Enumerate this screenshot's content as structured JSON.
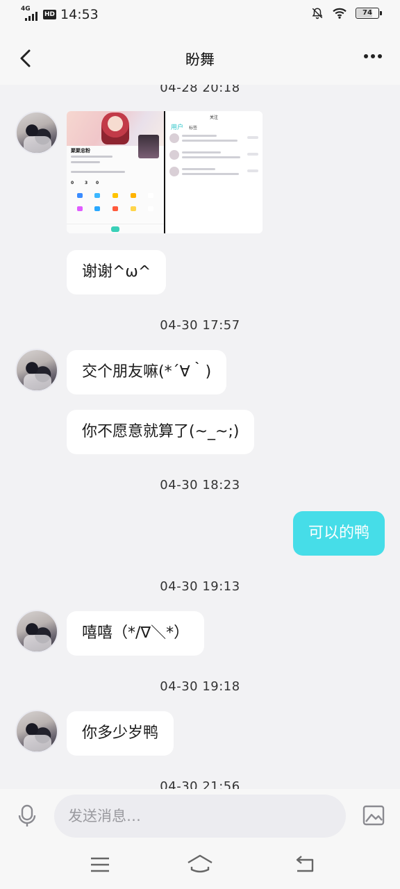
{
  "status_bar": {
    "network": "4G",
    "hd": "HD",
    "time": "14:53",
    "battery": "74",
    "icons": [
      "signal-icon",
      "hd-icon",
      "bell-muted-icon",
      "wifi-icon",
      "battery-icon"
    ]
  },
  "header": {
    "title": "盼舞",
    "back_icon": "chevron-left-icon",
    "more_icon": "more-dots-icon"
  },
  "messages": [
    {
      "type": "timestamp",
      "text": "04-28 20:18"
    },
    {
      "type": "image",
      "from": "other",
      "alt": "screenshot-thumbnail"
    },
    {
      "type": "text",
      "from": "other",
      "text": "谢谢^ω^"
    },
    {
      "type": "timestamp",
      "text": "04-30 17:57"
    },
    {
      "type": "text",
      "from": "other",
      "text": "交个朋友嘛(*´∀｀)"
    },
    {
      "type": "text",
      "from": "other",
      "text": "你不愿意就算了(~_~;)"
    },
    {
      "type": "timestamp",
      "text": "04-30 18:23"
    },
    {
      "type": "text",
      "from": "me",
      "text": "可以的鸭"
    },
    {
      "type": "timestamp",
      "text": "04-30 19:13"
    },
    {
      "type": "text",
      "from": "other",
      "text": "嘻嘻（*/∇＼*）"
    },
    {
      "type": "timestamp",
      "text": "04-30 19:18"
    },
    {
      "type": "text",
      "from": "other",
      "text": "你多少岁鸭"
    },
    {
      "type": "timestamp",
      "text": "04-30 21:56"
    }
  ],
  "image_thumbnail": {
    "left_name": "聚聚忠粉",
    "left_stats": [
      "0",
      "3",
      "0"
    ],
    "right_title": "关注",
    "right_tabs": [
      "用户",
      "标签"
    ]
  },
  "input_bar": {
    "placeholder": "发送消息…",
    "mic_icon": "microphone-icon",
    "image_icon": "image-icon"
  },
  "nav_bar": {
    "icons": [
      "menu-icon",
      "home-icon",
      "back-icon"
    ]
  },
  "colors": {
    "accent": "#46dde8",
    "background": "#f2f2f4",
    "bubble": "#ffffff"
  }
}
